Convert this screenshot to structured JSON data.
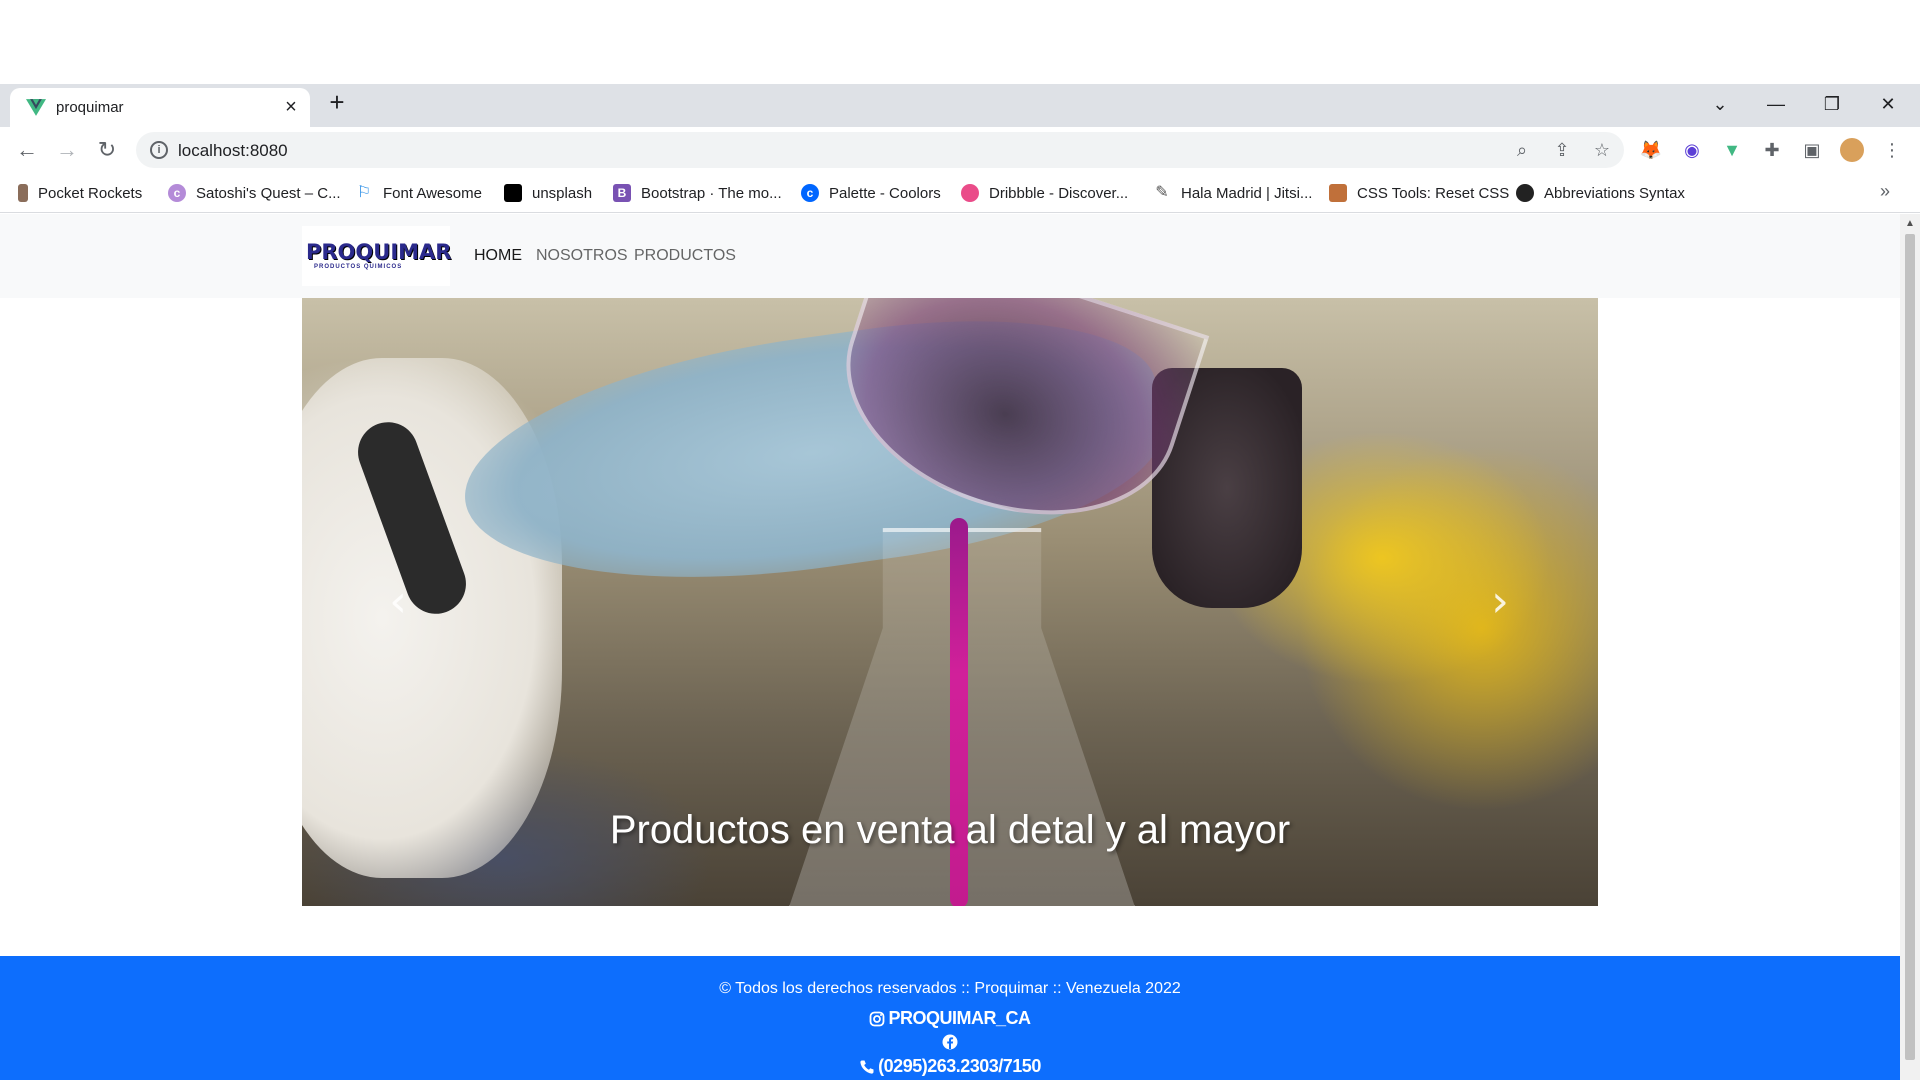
{
  "browser": {
    "tab": {
      "title": "proquimar",
      "favicon": "vue-icon"
    },
    "url": "localhost:8080",
    "bookmarks": [
      {
        "label": "Pocket Rockets",
        "icon": "rocket-icon",
        "color": "#8a6d5a"
      },
      {
        "label": "Satoshi's Quest – C...",
        "icon": "satoshi-icon",
        "color": "#9b59b6"
      },
      {
        "label": "Font Awesome",
        "icon": "flag-icon",
        "color": "#228ae6"
      },
      {
        "label": "unsplash",
        "icon": "unsplash-icon",
        "color": "#000000"
      },
      {
        "label": "Bootstrap · The mo...",
        "icon": "bootstrap-icon",
        "color": "#7952b3"
      },
      {
        "label": "Palette - Coolors",
        "icon": "coolors-icon",
        "color": "#0066ff"
      },
      {
        "label": "Dribbble - Discover...",
        "icon": "dribbble-icon",
        "color": "#ea4c89"
      },
      {
        "label": "Hala Madrid | Jitsi...",
        "icon": "feather-icon",
        "color": "#555555"
      },
      {
        "label": "CSS Tools: Reset CSS",
        "icon": "css-tools-icon",
        "color": "#c0703a"
      },
      {
        "label": "Abbreviations Syntax",
        "icon": "emmet-icon",
        "color": "#222222"
      }
    ]
  },
  "site": {
    "logo": {
      "name": "PROQUIMAR",
      "tagline": "PRODUCTOS QUIMICOS"
    },
    "nav": [
      {
        "label": "HOME",
        "active": true
      },
      {
        "label": "NOSOTROS",
        "active": false
      },
      {
        "label": "PRODUCTOS",
        "active": false
      }
    ],
    "carousel": {
      "caption": "Productos en venta al detal y al mayor",
      "prev_label": "‹",
      "next_label": "›"
    },
    "footer": {
      "copyright": "© Todos los derechos reservados :: Proquimar :: Venezuela 2022",
      "instagram": "PROQUIMAR_CA",
      "phone": "(0295)263.2303/7150"
    }
  },
  "colors": {
    "footer_bg": "#0d6efd",
    "nav_bg": "#f8f9fa",
    "tabstrip_bg": "#dee1e6"
  }
}
